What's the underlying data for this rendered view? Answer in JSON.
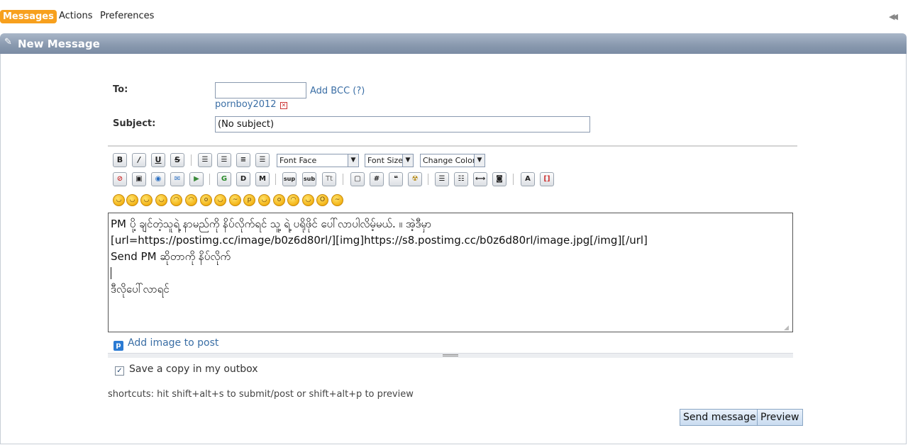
{
  "nav": {
    "tabs": [
      "Messages",
      "Actions",
      "Preferences"
    ],
    "active": "Messages"
  },
  "window": {
    "title": "New Message"
  },
  "form": {
    "to_label": "To:",
    "to_value": "",
    "add_bcc": "Add BCC (?)",
    "recipient": "pornboy2012",
    "subject_label": "Subject:",
    "subject_value": "(No subject)"
  },
  "toolbar": {
    "row1": [
      "B",
      "I",
      "U",
      "S"
    ],
    "font_face": "Font Face",
    "font_size": "Font Size",
    "change_color": "Change Color",
    "row2_labels": [
      "sup",
      "sub",
      "Tt",
      "#"
    ]
  },
  "editor": {
    "lines": [
      "PM ပို့ ချင်တဲ့သူရဲ့ နာမည်ကို နိပ်လိုက်ရင် သူ့ ရဲ့ ပရိုဖိုင် ပေါ်လာပါလိမ့်မယ်. ။ အဲ့ဒီမှာ",
      "[url=https://postimg.cc/image/b0z6d80rl/][img]https://s8.postimg.cc/b0z6d80rl/image.jpg[/img][/url]",
      "Send PM ဆိုတာကို နိပ်လိုက်",
      "",
      "ဒီလိုပေါ်လာရင်"
    ]
  },
  "add_image": "Add image to post",
  "save_copy": {
    "label": "Save a copy in my outbox",
    "checked": true
  },
  "shortcuts": "shortcuts: hit shift+alt+s to submit/post or shift+alt+p to preview",
  "buttons": {
    "send": "Send message",
    "preview": "Preview"
  },
  "colors": {
    "accent": "#f7a01d",
    "titlebar": "#8898ae",
    "link": "#3a6ea5"
  }
}
